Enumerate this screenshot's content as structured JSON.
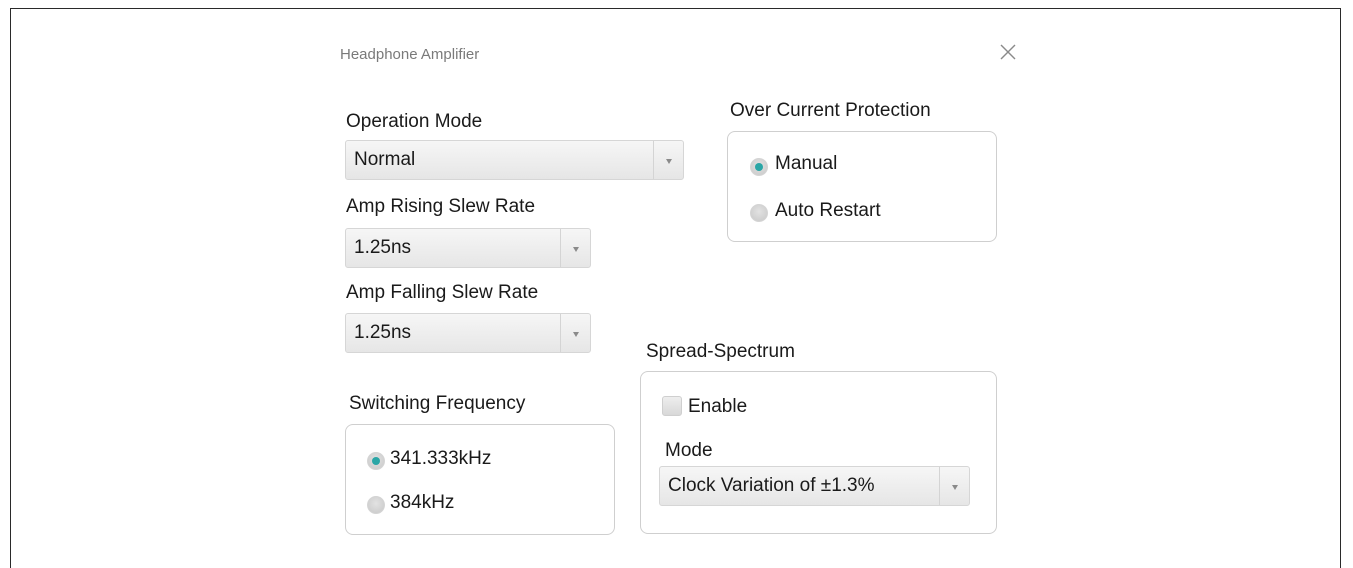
{
  "dialog": {
    "title": "Headphone Amplifier",
    "close_icon": "close-icon"
  },
  "operation_mode": {
    "label": "Operation Mode",
    "value": "Normal"
  },
  "amp_rising": {
    "label": "Amp Rising Slew Rate",
    "value": "1.25ns"
  },
  "amp_falling": {
    "label": "Amp Falling Slew Rate",
    "value": "1.25ns"
  },
  "over_current": {
    "label": "Over Current Protection",
    "options": [
      {
        "label": "Manual",
        "selected": true
      },
      {
        "label": "Auto Restart",
        "selected": false
      }
    ]
  },
  "switching_frequency": {
    "label": "Switching Frequency",
    "options": [
      {
        "label": "341.333kHz",
        "selected": true
      },
      {
        "label": "384kHz",
        "selected": false
      }
    ]
  },
  "spread_spectrum": {
    "label": "Spread-Spectrum",
    "enable_label": "Enable",
    "enable_checked": false,
    "mode_label": "Mode",
    "mode_value": "Clock Variation of ±1.3%"
  },
  "colors": {
    "accent": "#2aa6a6",
    "border": "#cfcfcf",
    "title": "#7a7a7a"
  }
}
